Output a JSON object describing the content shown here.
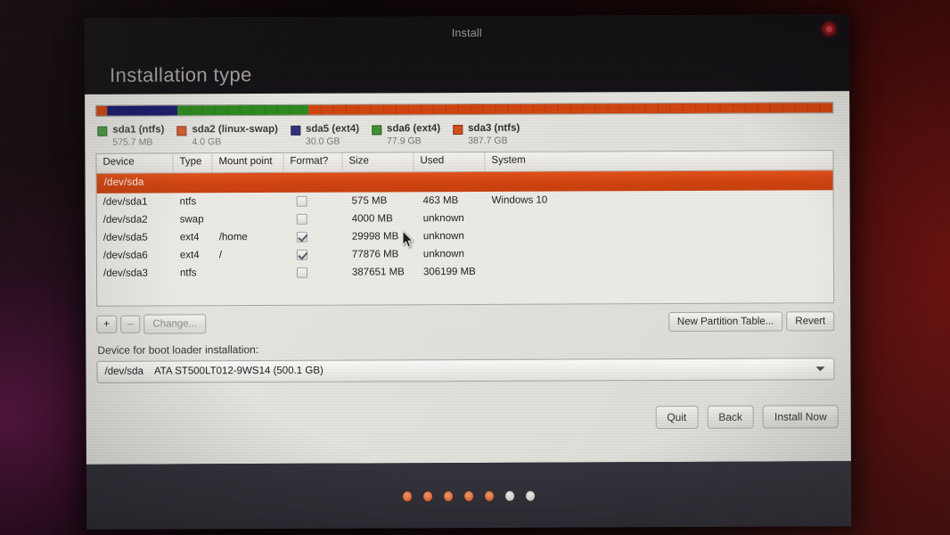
{
  "window": {
    "title": "Install",
    "close_icon": "close-icon",
    "page_title": "Installation type"
  },
  "usage_bar": {
    "segments": [
      {
        "name": "free-start",
        "color": "#d1450f",
        "percent": 1.4
      },
      {
        "name": "sda5 (ext4)",
        "color": "#1b1b6e",
        "percent": 9.6
      },
      {
        "name": "sda6 (ext4)",
        "color": "#2d8a1f",
        "percent": 17.8
      },
      {
        "name": "sda3 (ntfs)",
        "color": "#d1450f",
        "percent": 71.2
      }
    ]
  },
  "legend": [
    {
      "color": "#2d8a1f",
      "name": "sda1 (ntfs)",
      "size": "575.7 MB"
    },
    {
      "color": "#d1450f",
      "name": "sda2 (linux-swap)",
      "size": "4.0 GB"
    },
    {
      "color": "#1b1b6e",
      "name": "sda5 (ext4)",
      "size": "30.0 GB"
    },
    {
      "color": "#2d8a1f",
      "name": "sda6 (ext4)",
      "size": "77.9 GB"
    },
    {
      "color": "#d1450f",
      "name": "sda3 (ntfs)",
      "size": "387.7 GB"
    }
  ],
  "table": {
    "columns": [
      "Device",
      "Type",
      "Mount point",
      "Format?",
      "Size",
      "Used",
      "System"
    ],
    "disk_row": "/dev/sda",
    "rows": [
      {
        "device": "/dev/sda1",
        "type": "ntfs",
        "mount": "",
        "format": false,
        "size": "575 MB",
        "used": "463 MB",
        "system": "Windows 10"
      },
      {
        "device": "/dev/sda2",
        "type": "swap",
        "mount": "",
        "format": false,
        "size": "4000 MB",
        "used": "unknown",
        "system": ""
      },
      {
        "device": "/dev/sda5",
        "type": "ext4",
        "mount": "/home",
        "format": true,
        "size": "29998 MB",
        "used": "unknown",
        "system": ""
      },
      {
        "device": "/dev/sda6",
        "type": "ext4",
        "mount": "/",
        "format": true,
        "size": "77876 MB",
        "used": "unknown",
        "system": ""
      },
      {
        "device": "/dev/sda3",
        "type": "ntfs",
        "mount": "",
        "format": false,
        "size": "387651 MB",
        "used": "306199 MB",
        "system": ""
      }
    ]
  },
  "partition_tools": {
    "add_label": "+",
    "remove_label": "–",
    "change_label": "Change...",
    "new_table_label": "New Partition Table...",
    "revert_label": "Revert"
  },
  "bootloader": {
    "label": "Device for boot loader installation:",
    "selected_device": "/dev/sda",
    "selected_model": "ATA ST500LT012-9WS14 (500.1 GB)",
    "dropdown_icon": "chevron-down-icon"
  },
  "actions": {
    "quit_label": "Quit",
    "back_label": "Back",
    "install_label": "Install Now"
  },
  "footer": {
    "dots": [
      "on",
      "on",
      "on",
      "on",
      "on",
      "off",
      "off"
    ]
  },
  "colors": {
    "ubuntu_orange": "#d1450f",
    "highlight_row": "#d0430f",
    "green": "#2d8a1f",
    "navy": "#1b1b6e",
    "panel_bg": "#e3e1dc",
    "footer_bg": "#312f37"
  }
}
